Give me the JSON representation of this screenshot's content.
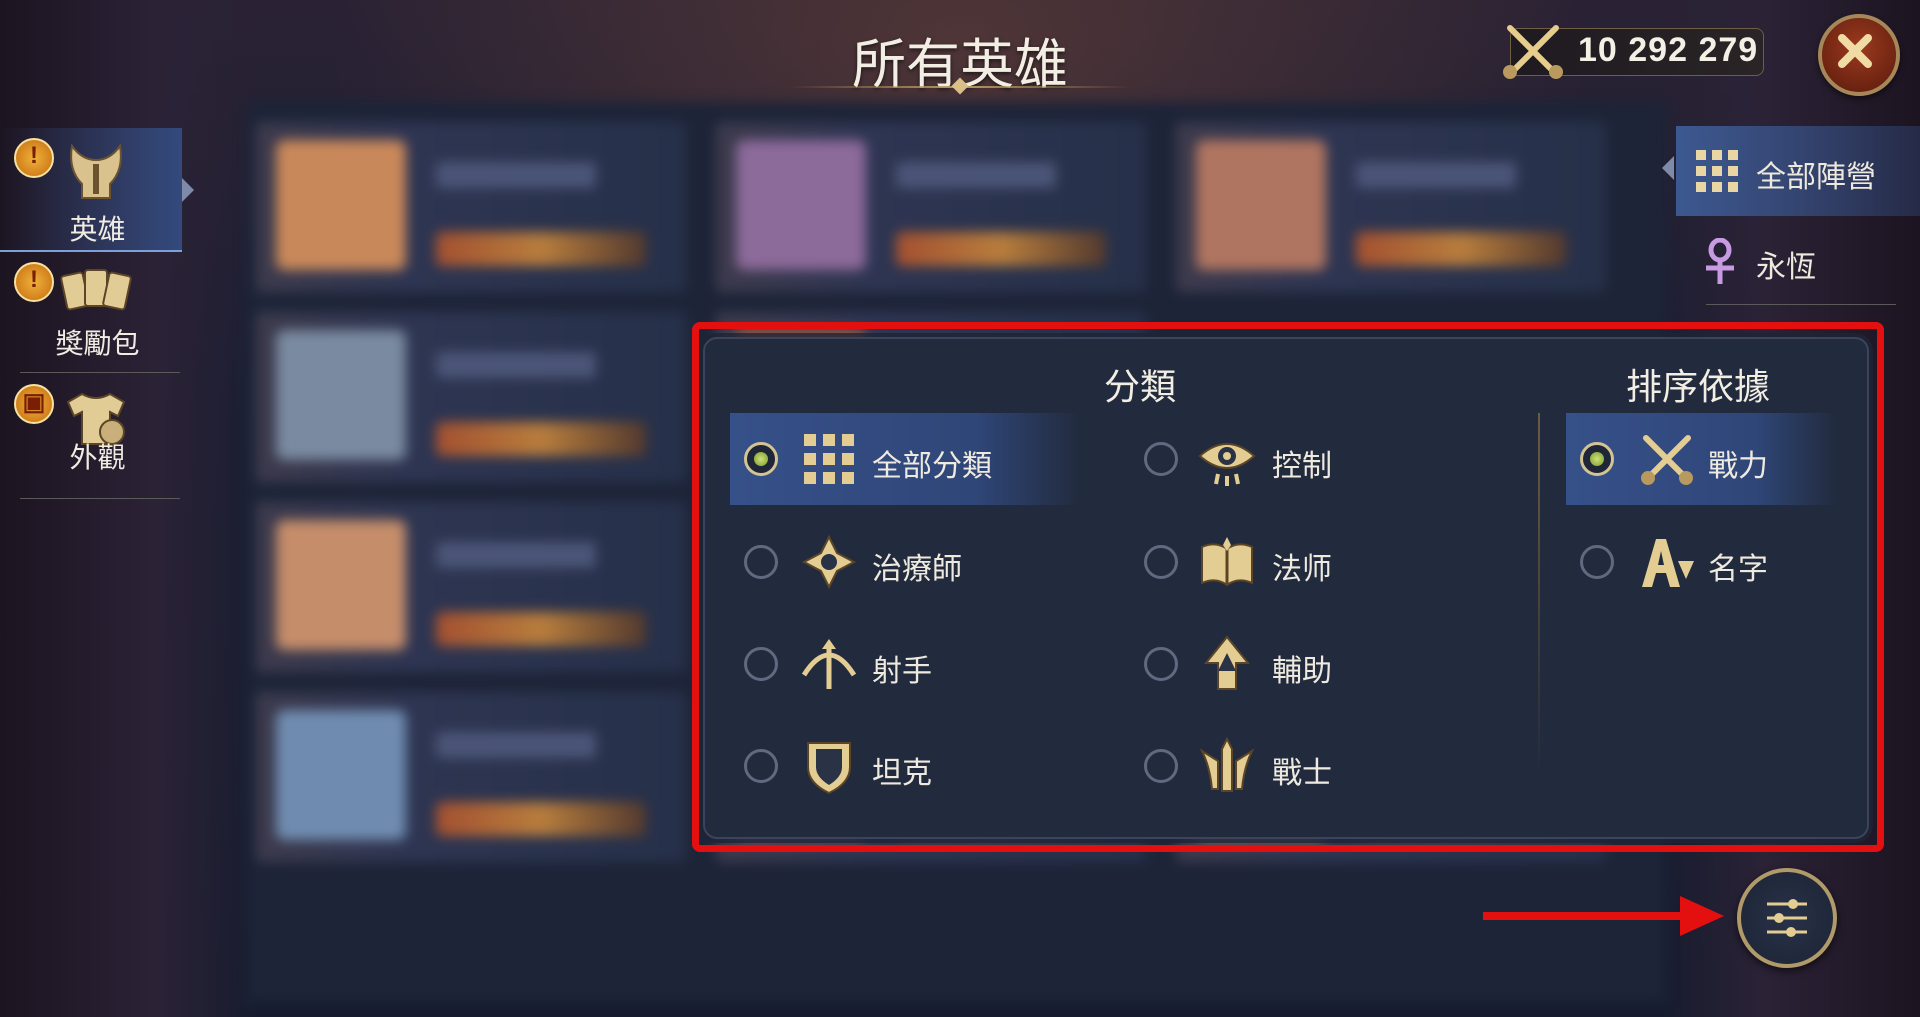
{
  "title": "所有英雄",
  "power": {
    "value": "10 292 279",
    "icon": "crossed-swords-icon"
  },
  "sidebar_left": {
    "items": [
      {
        "label": "英雄",
        "icon": "helmet-icon",
        "active": true,
        "notice": "!"
      },
      {
        "label": "獎勵包",
        "icon": "cards-icon",
        "active": false,
        "notice": "!"
      },
      {
        "label": "外觀",
        "icon": "outfit-icon",
        "active": false,
        "notice": "gift"
      }
    ]
  },
  "sidebar_right": {
    "items": [
      {
        "label": "全部陣營",
        "icon": "grid-icon",
        "active": true
      },
      {
        "label": "永恆",
        "icon": "ankh-icon",
        "active": false
      }
    ]
  },
  "filter_panel": {
    "category_title": "分類",
    "sort_title": "排序依據",
    "categories": [
      {
        "label": "全部分類",
        "icon": "grid-icon",
        "selected": true
      },
      {
        "label": "控制",
        "icon": "eye-icon",
        "selected": false
      },
      {
        "label": "治療師",
        "icon": "healer-icon",
        "selected": false
      },
      {
        "label": "法师",
        "icon": "spellbook-icon",
        "selected": false
      },
      {
        "label": "射手",
        "icon": "bow-icon",
        "selected": false
      },
      {
        "label": "輔助",
        "icon": "support-arrow-icon",
        "selected": false
      },
      {
        "label": "坦克",
        "icon": "shield-icon",
        "selected": false
      },
      {
        "label": "戰士",
        "icon": "warrior-icon",
        "selected": false
      }
    ],
    "sort_options": [
      {
        "label": "戰力",
        "icon": "crossed-swords-icon",
        "selected": true
      },
      {
        "label": "名字",
        "icon": "alpha-sort-icon",
        "selected": false
      }
    ]
  },
  "colors": {
    "highlight": "#e41010",
    "panel": "#222b3e",
    "selected": "#365089",
    "gold": "#d8bf88"
  }
}
